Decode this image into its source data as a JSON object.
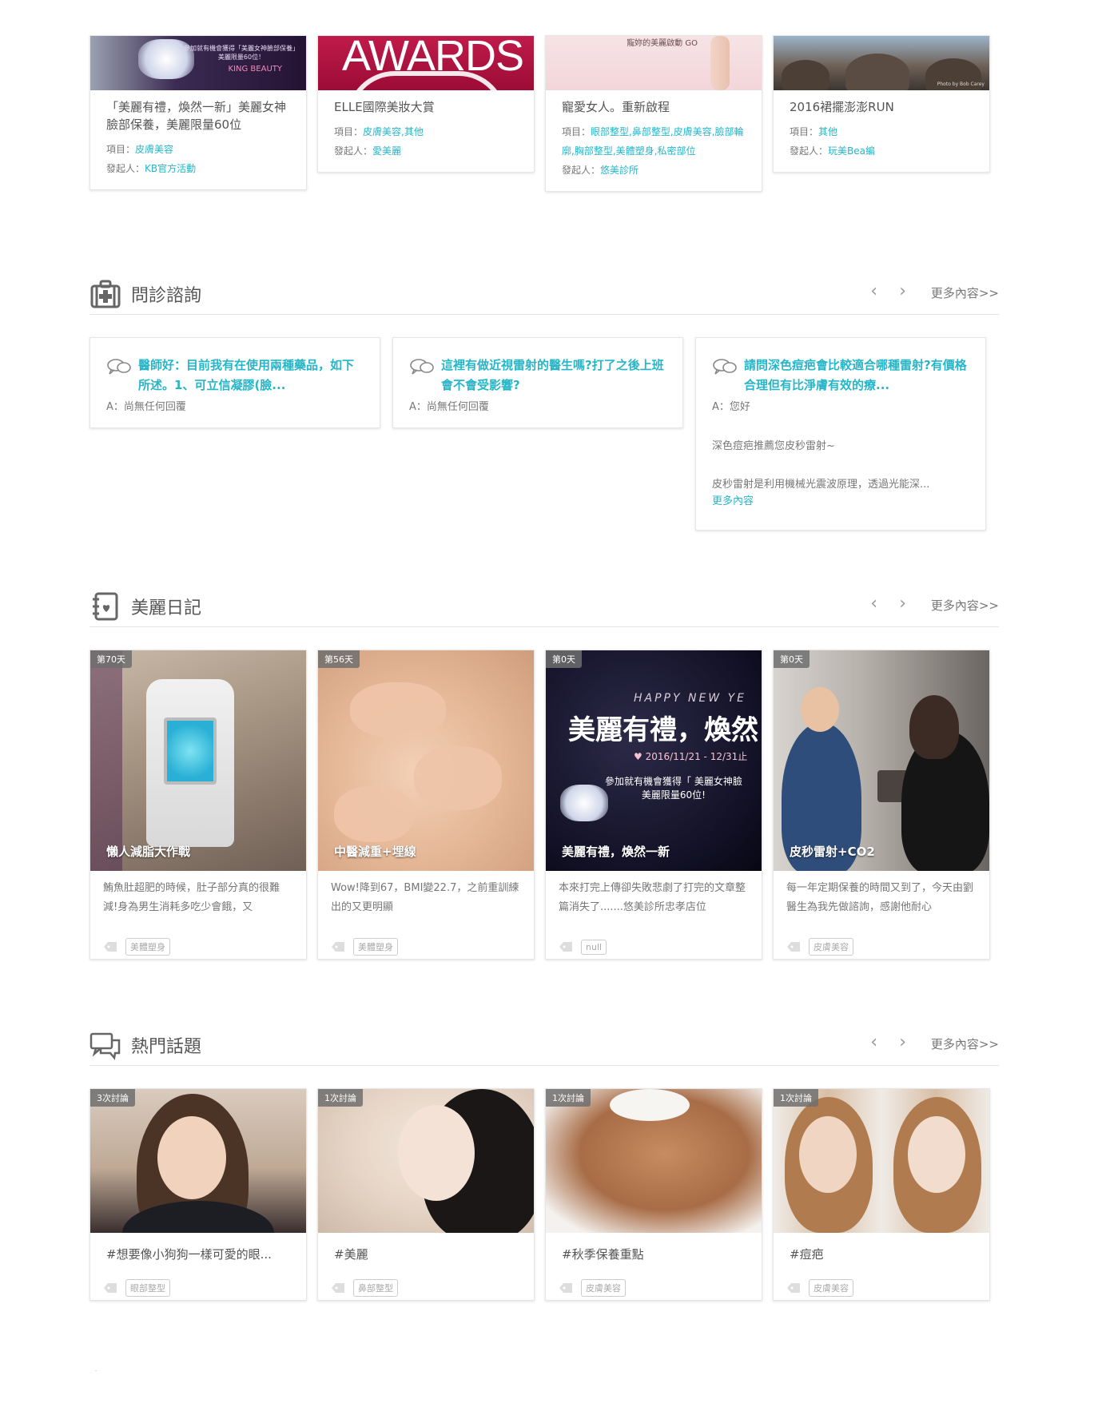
{
  "activities": [
    {
      "title": "「美麗有禮，煥然一新」美麗女神臉部保養，美麗限量60位",
      "project_label": "項目：",
      "project": "皮膚美容",
      "initiator_label": "發起人：",
      "initiator": "KB官方活動",
      "thumb_text": "參加就有機會獲得「美麗女神臉部保養」美麗限量60位！",
      "thumb_logo": "KING BEAUTY"
    },
    {
      "title": "ELLE國際美妝大賞",
      "project_label": "項目：",
      "project": "皮膚美容,其他",
      "initiator_label": "發起人：",
      "initiator": "愛美麗",
      "thumb_text": "AWARDS"
    },
    {
      "title": "寵愛女人。重新啟程",
      "project_label": "項目：",
      "project": "眼部整型,鼻部整型,皮膚美容,臉部輪廓,胸部整型,美體塑身,私密部位",
      "initiator_label": "發起人：",
      "initiator": "悠美診所",
      "thumb_text": "寵妳的美麗啟動 GO"
    },
    {
      "title": "2016裙擺澎澎RUN",
      "project_label": "項目：",
      "project": "其他",
      "initiator_label": "發起人：",
      "initiator": "玩美Bea編",
      "thumb_text": "Photo by Bob Carey"
    }
  ],
  "consult": {
    "title": "問診諮詢",
    "prev": "‹",
    "next": "›",
    "more": "更多內容>>",
    "items": [
      {
        "question": "醫師好：目前我有在使用兩種藥品，如下所述。1、可立信凝膠(臉...",
        "answer": "A：尚無任何回覆"
      },
      {
        "question": "這裡有做近視雷射的醫生嗎?打了之後上班會不會受影響?",
        "answer": "A：尚無任何回覆"
      },
      {
        "question": "請問深色痘疤會比較適合哪種雷射?有價格合理但有比淨膚有效的療...",
        "answer": "A：您好",
        "paragraph1": "深色痘疤推薦您皮秒雷射~",
        "paragraph2": "皮秒雷射是利用機械光震波原理，透過光能深...",
        "more_link": "更多內容"
      }
    ]
  },
  "diary": {
    "title": "美麗日記",
    "prev": "‹",
    "next": "›",
    "more": "更多內容>>",
    "items": [
      {
        "badge": "第70天",
        "caption": "懶人減脂大作戰",
        "desc": "鮪魚肚超肥的時候，肚子部分真的很難減!身為男生消耗多吃少會餓，又",
        "tag": "美體塑身"
      },
      {
        "badge": "第56天",
        "caption": "中醫減重+埋線",
        "desc": "Wow!降到67，BMI變22.7，之前重訓練出的又更明顯",
        "tag": "美體塑身"
      },
      {
        "badge": "第0天",
        "caption": "美麗有禮，煥然一新",
        "desc": "本來打完上傳卻失敗悲劇了打完的文章整篇消失了.......悠美診所忠孝店位",
        "tag": "null",
        "img_text": {
          "hny": "HAPPY NEW YE",
          "big": "美麗有禮，煥然",
          "date": "♥ 2016/11/21 - 12/31止",
          "ann1": "參加就有機會獲得「 美麗女神臉",
          "ann2": "美麗限量60位!"
        }
      },
      {
        "badge": "第0天",
        "caption": "皮秒雷射+CO2",
        "desc": "每一年定期保養的時間又到了，今天由劉醫生為我先做諮詢，感謝他耐心",
        "tag": "皮膚美容"
      }
    ]
  },
  "topics": {
    "title": "熱門話題",
    "prev": "‹",
    "next": "›",
    "more": "更多內容>>",
    "items": [
      {
        "badge": "3次討論",
        "title": "#想要像小狗狗一樣可愛的眼...",
        "tag": "眼部整型"
      },
      {
        "badge": "1次討論",
        "title": "#美麗",
        "tag": "鼻部整型"
      },
      {
        "badge": "1次討論",
        "title": "#秋季保養重點",
        "tag": "皮膚美容"
      },
      {
        "badge": "1次討論",
        "title": "#痘疤",
        "tag": "皮膚美容"
      }
    ]
  },
  "colors": {
    "accent": "#26b6c8",
    "text": "#555555",
    "muted": "#777777"
  }
}
